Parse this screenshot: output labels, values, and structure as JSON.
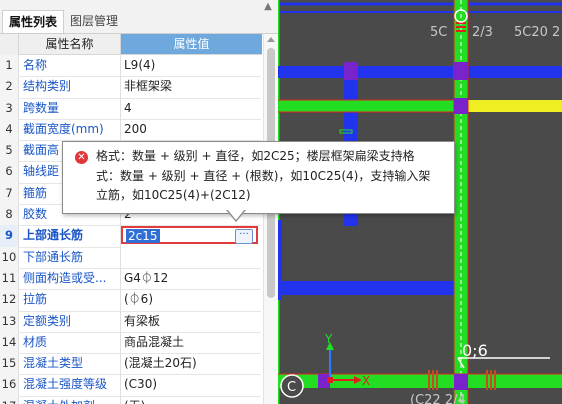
{
  "tabs": {
    "properties": "属性列表",
    "layers": "图层管理"
  },
  "table": {
    "header": {
      "name": "属性名称",
      "value": "属性值"
    },
    "rows": [
      {
        "n": "1",
        "name": "名称",
        "value": "L9(4)"
      },
      {
        "n": "2",
        "name": "结构类别",
        "value": "非框架梁"
      },
      {
        "n": "3",
        "name": "跨数量",
        "value": "4"
      },
      {
        "n": "4",
        "name": "截面宽度(mm)",
        "value": "200"
      },
      {
        "n": "5",
        "name": "截面高",
        "value": ""
      },
      {
        "n": "6",
        "name": "轴线距",
        "value": ""
      },
      {
        "n": "7",
        "name": "箍筋",
        "value": ""
      },
      {
        "n": "8",
        "name": "胶数",
        "value": "2"
      },
      {
        "n": "9",
        "name": "上部通长筋",
        "value": "2c15"
      },
      {
        "n": "10",
        "name": "下部通长筋",
        "value": ""
      },
      {
        "n": "11",
        "name": "侧面构造或受...",
        "value": "G4⏀12"
      },
      {
        "n": "12",
        "name": "拉筋",
        "value": "(⏀6)"
      },
      {
        "n": "13",
        "name": "定额类别",
        "value": "有梁板"
      },
      {
        "n": "14",
        "name": "材质",
        "value": "商品混凝土"
      },
      {
        "n": "15",
        "name": "混凝土类型",
        "value": "(混凝土20石)"
      },
      {
        "n": "16",
        "name": "混凝土强度等级",
        "value": "(C30)"
      },
      {
        "n": "17",
        "name": "混凝土外加剂",
        "value": "(无)"
      }
    ],
    "active_row": 9,
    "edit_button": "···"
  },
  "tooltip": {
    "lines": [
      "格式：数量 + 级别 + 直径，如2C25；楼层框架扁梁支持格",
      "式：数量 + 级别 + 直径 + (根数)，如10C25(4)，支持输入架",
      "立筋，如10C25(4)+(2C12)"
    ]
  },
  "canvas": {
    "labels": {
      "top_left": "5C",
      "top_mid": "2/3",
      "top_right": "5C20 2",
      "bottom_label": "0;6",
      "bottom_rebar": "(C22 2/4",
      "axis_x": "X",
      "axis_y": "Y",
      "grid_marker": "C"
    },
    "colors": {
      "background": "#4a4a4a",
      "beam_green": "#22dd22",
      "beam_blue": "#2233ee",
      "beam_yellow": "#eeee22",
      "node_purple": "#7a22cc",
      "selection_red": "#e02020"
    }
  }
}
